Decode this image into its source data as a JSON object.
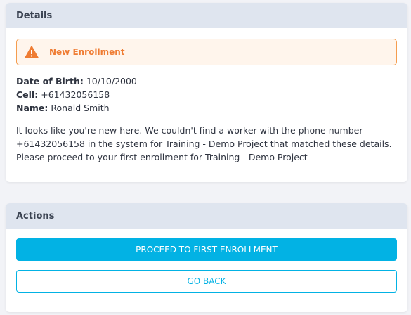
{
  "details": {
    "header_title": "Details",
    "alert": {
      "icon": "warning-triangle-icon",
      "title": "New Enrollment",
      "color": "#ef7c33",
      "background": "#fff5ec"
    },
    "fields": [
      {
        "label": "Date of Birth:",
        "value": "10/10/2000"
      },
      {
        "label": "Cell:",
        "value": "+61432056158"
      },
      {
        "label": "Name:",
        "value": "Ronald Smith"
      }
    ],
    "message": "It looks like you're new here. We couldn't find a worker with the phone number +61432056158 in the system for Training - Demo Project that matched these details. Please proceed to your first enrollment for Training - Demo Project"
  },
  "actions": {
    "header_title": "Actions",
    "proceed_label": "PROCEED TO FIRST ENROLLMENT",
    "back_label": "GO BACK",
    "accent_color": "#02b2e4"
  }
}
